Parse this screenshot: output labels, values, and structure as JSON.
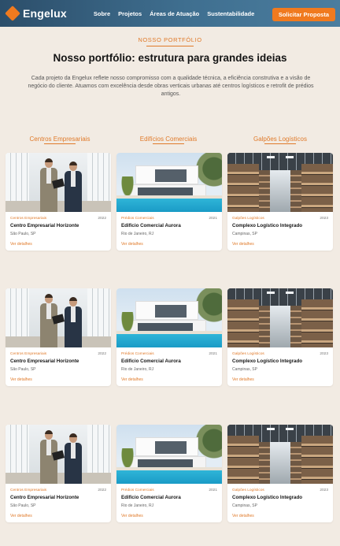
{
  "nav": {
    "brand": "Engelux",
    "links": [
      "Sobre",
      "Projetos",
      "Áreas de Atuação",
      "Sustentabilidade"
    ],
    "cta": "Solicitar Proposta",
    "accent": "#f07a1f"
  },
  "hero": {
    "eyebrow": "NOSSO PORTFÓLIO",
    "title": "Nosso portfólio: estrutura para grandes ideias",
    "description": "Cada projeto da Engelux reflete nosso compromisso com a qualidade técnica, a eficiência construtiva e a visão de negócio do cliente. Atuamos com excelência desde obras verticais urbanas até centros logísticos e retrofit de prédios antigos."
  },
  "categories": [
    "Centros Empresariais",
    "Edifícios Comerciais",
    "Galpões Logísticos"
  ],
  "rows": [
    [
      {
        "category": "Centros Empresariais",
        "year": "2022",
        "title": "Centro Empresarial Horizonte",
        "location": "São Paulo, SP",
        "link": "Ver detalhes"
      },
      {
        "category": "Prédios Comerciais",
        "year": "2021",
        "title": "Edifício Comercial Aurora",
        "location": "Rio de Janeiro, RJ",
        "link": "Ver detalhes"
      },
      {
        "category": "Galpões Logísticos",
        "year": "2023",
        "title": "Complexo Logístico Integrado",
        "location": "Campinas, SP",
        "link": "Ver detalhes"
      }
    ],
    [
      {
        "category": "Centros Empresariais",
        "year": "2022",
        "title": "Centro Empresarial Horizonte",
        "location": "São Paulo, SP",
        "link": "Ver detalhes"
      },
      {
        "category": "Prédios Comerciais",
        "year": "2021",
        "title": "Edifício Comercial Aurora",
        "location": "Rio de Janeiro, RJ",
        "link": "Ver detalhes"
      },
      {
        "category": "Galpões Logísticos",
        "year": "2023",
        "title": "Complexo Logístico Integrado",
        "location": "Campinas, SP",
        "link": "Ver detalhes"
      }
    ],
    [
      {
        "category": "Centros Empresariais",
        "year": "2022",
        "title": "Centro Empresarial Horizonte",
        "location": "São Paulo, SP",
        "link": "Ver detalhes"
      },
      {
        "category": "Prédios Comerciais",
        "year": "2021",
        "title": "Edifício Comercial Aurora",
        "location": "Rio de Janeiro, RJ",
        "link": "Ver detalhes"
      },
      {
        "category": "Galpões Logísticos",
        "year": "2023",
        "title": "Complexo Logístico Integrado",
        "location": "Campinas, SP",
        "link": "Ver detalhes"
      }
    ]
  ]
}
